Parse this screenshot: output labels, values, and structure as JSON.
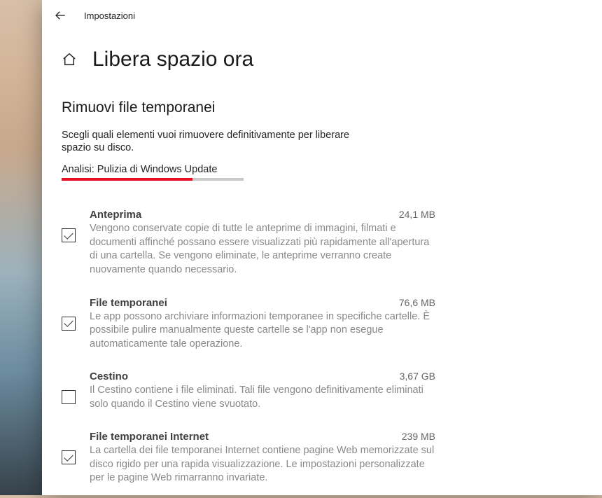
{
  "titlebar": {
    "title": "Impostazioni"
  },
  "page": {
    "title": "Libera spazio ora"
  },
  "section": {
    "title": "Rimuovi file temporanei",
    "description": "Scegli quali elementi vuoi rimuovere definitivamente per liberare spazio su disco.",
    "analysis_label": "Analisi: Pulizia di Windows Update"
  },
  "items": [
    {
      "title": "Anteprima",
      "size": "24,1 MB",
      "checked": true,
      "description": "Vengono conservate copie di tutte le anteprime di immagini, filmati e documenti affinché possano essere visualizzati più rapidamente all'apertura di una cartella. Se vengono eliminate, le anteprime verranno create nuovamente quando necessario."
    },
    {
      "title": "File temporanei",
      "size": "76,6 MB",
      "checked": true,
      "description": "Le app possono archiviare informazioni temporanee in specifiche cartelle. È possibile pulire manualmente queste cartelle se l'app non esegue automaticamente tale operazione."
    },
    {
      "title": "Cestino",
      "size": "3,67 GB",
      "checked": false,
      "description": "Il Cestino contiene i file eliminati. Tali file vengono definitivamente eliminati solo quando il Cestino viene svuotato."
    },
    {
      "title": "File temporanei Internet",
      "size": "239 MB",
      "checked": true,
      "description": "La cartella dei file temporanei Internet contiene pagine Web memorizzate sul disco rigido per una rapida visualizzazione. Le impostazioni personalizzate per le pagine Web rimarranno invariate."
    }
  ]
}
